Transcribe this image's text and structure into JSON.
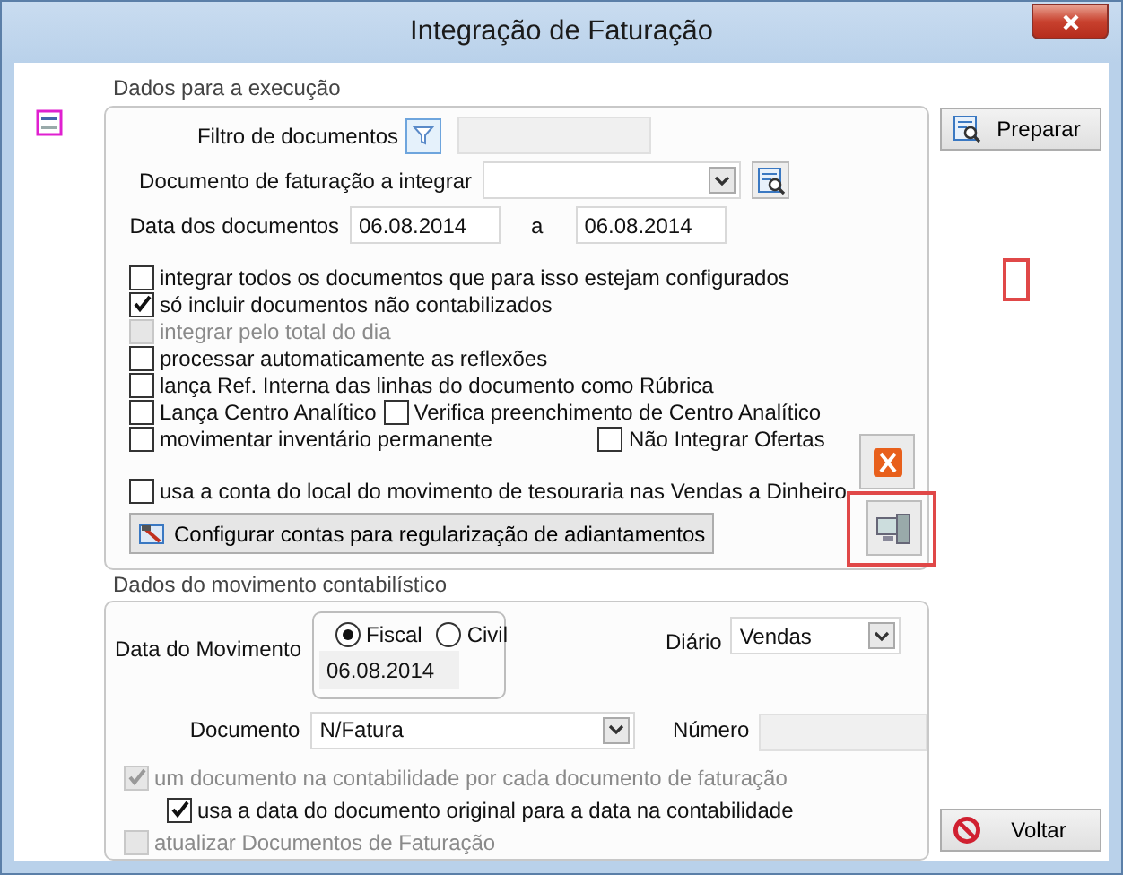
{
  "window": {
    "title": "Integração de Faturação"
  },
  "execution": {
    "title": "Dados para a execução",
    "filter": {
      "label": "Filtro de documentos"
    },
    "document": {
      "label": "Documento de faturação a integrar"
    },
    "dates": {
      "label": "Data dos documentos",
      "from": "06.08.2014",
      "separator": "a",
      "to": "06.08.2014"
    },
    "option_rows": [
      {
        "kind": "single",
        "items": [
          {
            "label": "integrar todos os documentos que para isso estejam configurados",
            "checked": false,
            "disabled": false
          }
        ]
      },
      {
        "kind": "single",
        "items": [
          {
            "label": "só incluir documentos não contabilizados",
            "checked": true,
            "disabled": false
          }
        ]
      },
      {
        "kind": "single",
        "items": [
          {
            "label": "integrar pelo total do dia",
            "checked": false,
            "disabled": true
          }
        ]
      },
      {
        "kind": "single",
        "items": [
          {
            "label": "processar automaticamente as reflexões",
            "checked": false,
            "disabled": false
          }
        ]
      },
      {
        "kind": "single",
        "items": [
          {
            "label": "lança Ref. Interna das linhas do documento como Rúbrica",
            "checked": false,
            "disabled": false
          }
        ]
      },
      {
        "kind": "pair",
        "items": [
          {
            "label": "Lança Centro Analítico",
            "checked": false,
            "disabled": false
          },
          {
            "label": "Verifica preenchimento de Centro Analítico",
            "checked": false,
            "disabled": false
          }
        ]
      },
      {
        "kind": "split",
        "items": [
          {
            "label": "movimentar inventário permanente",
            "checked": false,
            "disabled": false
          },
          {
            "label": "Não Integrar Ofertas",
            "checked": false,
            "disabled": false
          }
        ]
      }
    ],
    "cash_option": {
      "label": "usa a conta do local do movimento de tesouraria nas Vendas a Dinheiro",
      "checked": false,
      "disabled": false
    },
    "configure_button": "Configurar contas para regularização de adiantamentos"
  },
  "movement": {
    "title": "Dados do movimento contabilístico",
    "date_label": "Data do Movimento",
    "radios": [
      {
        "label": "Fiscal",
        "selected": true
      },
      {
        "label": "Civil",
        "selected": false
      }
    ],
    "date": "06.08.2014",
    "journal": {
      "label": "Diário",
      "value": "Vendas"
    },
    "document": {
      "label": "Documento",
      "value": "N/Fatura"
    },
    "number": {
      "label": "Número"
    },
    "options": [
      {
        "label": "um documento na contabilidade por cada documento de faturação",
        "checked": true,
        "disabled": true,
        "nested": false
      },
      {
        "label": "usa a data do documento original para a data na contabilidade",
        "checked": true,
        "disabled": false,
        "nested": true
      },
      {
        "label": "atualizar Documentos de Faturação",
        "checked": false,
        "disabled": true,
        "nested": false
      }
    ]
  },
  "buttons": {
    "prepare": "Preparar",
    "back": "Voltar"
  }
}
